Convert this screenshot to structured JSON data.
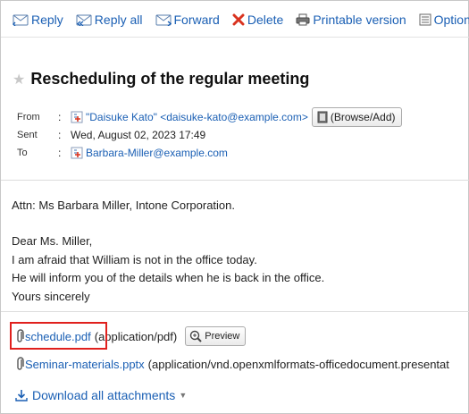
{
  "toolbar": {
    "reply": "Reply",
    "reply_all": "Reply all",
    "forward": "Forward",
    "delete": "Delete",
    "printable": "Printable version",
    "options": "Options"
  },
  "mail": {
    "subject": "Rescheduling of the regular meeting",
    "from_label": "From",
    "from_value": "\"Daisuke Kato\" <daisuke-kato@example.com>",
    "browse_add": "(Browse/Add)",
    "sent_label": "Sent",
    "sent_value": "Wed, August 02, 2023 17:49",
    "to_label": "To",
    "to_value": "Barbara-Miller@example.com",
    "colon": ":"
  },
  "body": {
    "line1": "Attn: Ms Barbara Miller, Intone Corporation.",
    "line2": "Dear Ms. Miller,",
    "line3": "I am afraid that William is not in the office today.",
    "line4": "He will inform you of the details when he is back in the office.",
    "line5": "Yours sincerely"
  },
  "attachments": [
    {
      "name": "schedule.pdf",
      "type": "(application/pdf)",
      "preview": "Preview"
    },
    {
      "name": "Seminar-materials.pptx",
      "type": "(application/vnd.openxmlformats-officedocument.presentat"
    }
  ],
  "download_all": "Download all attachments",
  "colors": {
    "link": "#1a5fb4",
    "highlight": "#e0201d",
    "delete_icon": "#d9331f"
  }
}
